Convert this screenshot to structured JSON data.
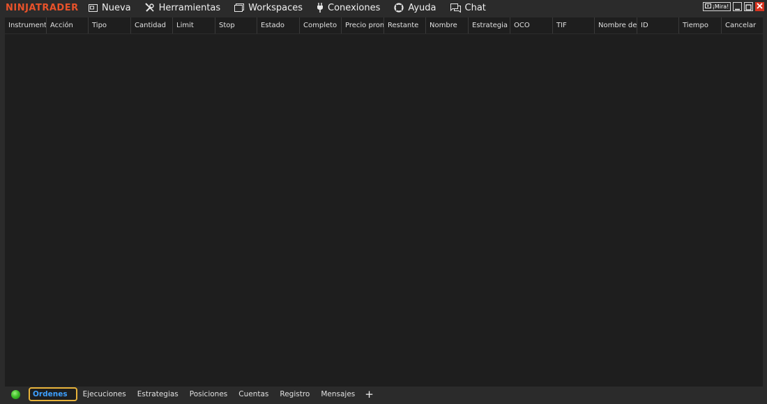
{
  "app": {
    "logo": "NINJATRADER"
  },
  "menu": [
    {
      "label": "Nueva",
      "icon": "new-window-icon"
    },
    {
      "label": "Herramientas",
      "icon": "tools-icon"
    },
    {
      "label": "Workspaces",
      "icon": "workspaces-icon"
    },
    {
      "label": "Conexiones",
      "icon": "plug-icon"
    },
    {
      "label": "Ayuda",
      "icon": "help-lifebuoy-icon"
    },
    {
      "label": "Chat",
      "icon": "chat-icon"
    }
  ],
  "window": {
    "watch_label": "¡Mira!"
  },
  "columns": [
    "Instrumento",
    "Acción",
    "Tipo",
    "Cantidad",
    "Limit",
    "Stop",
    "Estado",
    "Completo",
    "Precio promedio",
    "Restante",
    "Nombre",
    "Estrategia",
    "OCO",
    "TIF",
    "Nombre de cuenta",
    "ID",
    "Tiempo",
    "Cancelar"
  ],
  "tabs": [
    {
      "label": "Ordenes",
      "active": true
    },
    {
      "label": "Ejecuciones",
      "active": false
    },
    {
      "label": "Estrategias",
      "active": false
    },
    {
      "label": "Posiciones",
      "active": false
    },
    {
      "label": "Cuentas",
      "active": false
    },
    {
      "label": "Registro",
      "active": false
    },
    {
      "label": "Mensajes",
      "active": false
    }
  ],
  "tab_add_label": "+",
  "colors": {
    "logo": "#e8522a",
    "active_tab_text": "#3ea0ff",
    "active_tab_outline": "#e8b33a",
    "status": "#3fbf2a"
  }
}
